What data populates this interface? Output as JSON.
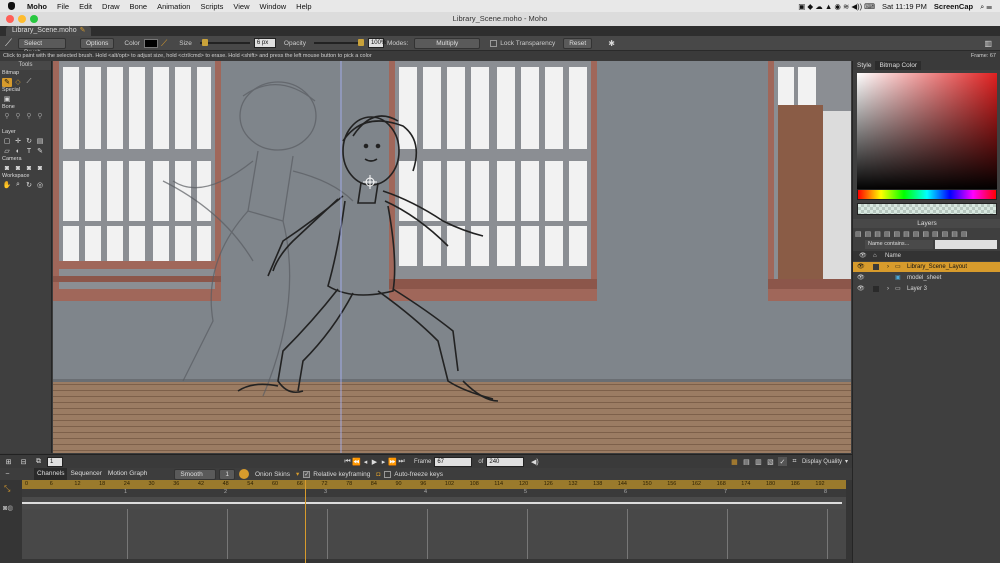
{
  "menubar": {
    "app": "Moho",
    "items": [
      "File",
      "Edit",
      "Draw",
      "Bone",
      "Animation",
      "Scripts",
      "View",
      "Window",
      "Help"
    ],
    "clock": "Sat 11:19 PM",
    "user": "ScreenCap"
  },
  "window": {
    "title": "Library_Scene.moho - Moho",
    "tab": "Library_Scene.moho"
  },
  "toolbar": {
    "brush": "Select Brush",
    "options": "Options",
    "color_label": "Color",
    "size_label": "Size",
    "size_value": "6 px",
    "opacity_label": "Opacity",
    "opacity_value": "100%",
    "modes_label": "Modes:",
    "modes_value": "Multiply",
    "lock_transparency": "Lock Transparency",
    "reset": "Reset",
    "frame_status": "Frame: 67"
  },
  "hint": "Click to paint with the selected brush. Hold <alt/opt> to adjust size, hold <ctrl/cmd> to erase. Hold <shift> and press the left mouse button to pick a color",
  "tools": {
    "title": "Tools",
    "sections": [
      "Bitmap",
      "Special",
      "Bone",
      "Layer",
      "Camera",
      "Workspace"
    ]
  },
  "right_panel": {
    "tabs": [
      "Style",
      "Bitmap Color"
    ],
    "layers_title": "Layers",
    "filter": "Name contains...",
    "name_col": "Name",
    "layers": [
      {
        "name": "Library_Scene_Layout",
        "selected": true
      },
      {
        "name": "model_sheet",
        "selected": false
      },
      {
        "name": "Layer 3",
        "selected": false
      }
    ]
  },
  "controls": {
    "frame_start": "1",
    "frame_label": "Frame",
    "frame_value": "67",
    "of_label": "of",
    "frame_total": "240",
    "display_quality": "Display Quality"
  },
  "timeline": {
    "tabs": [
      "Channels",
      "Sequencer",
      "Motion Graph"
    ],
    "interp": "Smooth",
    "interp_num": "1",
    "onion_skins": "Onion Skins",
    "relative_keyframing": "Relative keyframing",
    "auto_freeze": "Auto-freeze keys",
    "ruler_ticks": [
      "0",
      "6",
      "12",
      "18",
      "24",
      "30",
      "36",
      "42",
      "48",
      "54",
      "60",
      "66",
      "72",
      "78",
      "84",
      "90",
      "96",
      "102",
      "108",
      "114",
      "120",
      "126",
      "132",
      "138",
      "144",
      "150",
      "156",
      "162",
      "168",
      "174",
      "180",
      "186",
      "192"
    ],
    "seconds": [
      "1",
      "2",
      "3",
      "4",
      "5",
      "6",
      "7",
      "8"
    ]
  },
  "colors": {
    "accent": "#d79b2c",
    "wall": "#7f858b",
    "floor": "#9b7c63",
    "window_frame": "#a0675a"
  }
}
